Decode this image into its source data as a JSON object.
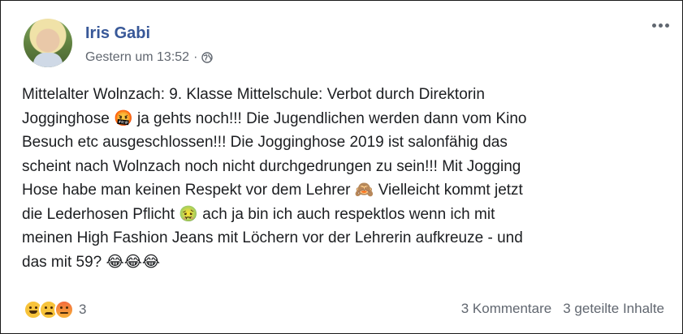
{
  "post": {
    "author": "Iris Gabi",
    "timestamp": "Gestern um 13:52",
    "separator": "·",
    "privacy_icon": "globe-icon",
    "more_icon": "more-horizontal-icon",
    "text": "Mittelalter Wolnzach: 9. Klasse Mittelschule: Verbot durch Direktorin\nJogginghose 🤬 ja gehts noch!!! Die Jugendlichen werden dann vom Kino\nBesuch etc ausgeschlossen!!! Die Jogginghose 2019 ist salonfähig das\nscheint nach Wolnzach noch nicht durchgedrungen zu sein!!! Mit Jogging\nHose habe man keinen Respekt vor dem Lehrer 🙈 Vielleicht kommt jetzt\ndie Lederhosen Pflicht 🤢 ach ja bin ich auch respektlos wenn ich mit\nmeinen High Fashion Jeans mit Löchern vor der Lehrerin aufkreuze - und\ndas mit 59? 😂😂😂"
  },
  "footer": {
    "reactions": [
      "haha",
      "sad",
      "angry"
    ],
    "reaction_count": "3",
    "comments": "3 Kommentare",
    "shares": "3 geteilte Inhalte"
  }
}
